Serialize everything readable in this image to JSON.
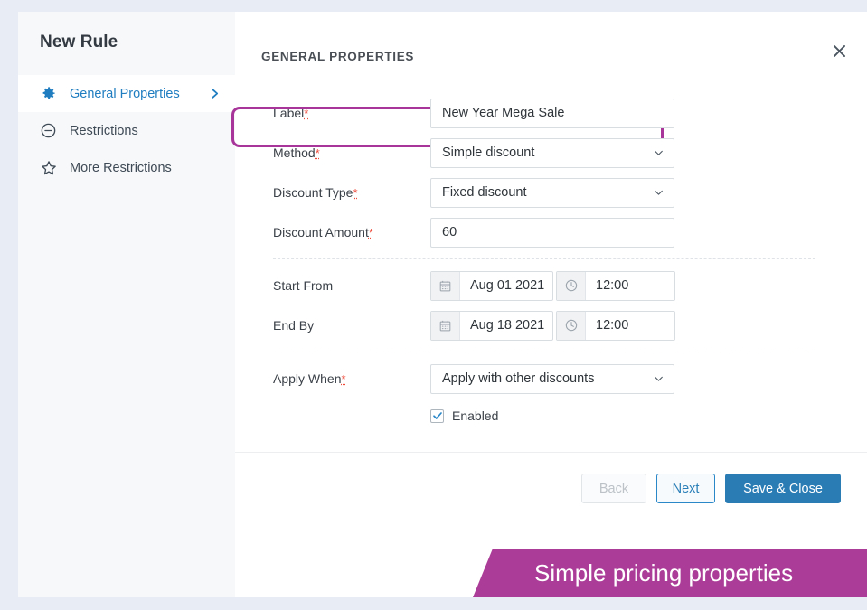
{
  "sidebar": {
    "title": "New Rule",
    "items": [
      {
        "label": "General Properties",
        "icon": "gear-icon",
        "active": true,
        "chevron": "chevron-right-icon"
      },
      {
        "label": "Restrictions",
        "icon": "circle-minus-icon",
        "active": false
      },
      {
        "label": "More Restrictions",
        "icon": "star-icon",
        "active": false
      }
    ]
  },
  "header": {
    "section_title": "GENERAL PROPERTIES",
    "close_icon": "close-icon"
  },
  "form": {
    "required_marker": "*",
    "fields": {
      "label": {
        "label": "Label",
        "value": "New Year Mega Sale",
        "required": true
      },
      "method": {
        "label": "Method",
        "value": "Simple discount",
        "required": true,
        "highlighted": true
      },
      "discount_type": {
        "label": "Discount Type",
        "value": "Fixed discount",
        "required": true
      },
      "discount_amount": {
        "label": "Discount Amount",
        "value": "60",
        "required": true
      },
      "start_from": {
        "label": "Start From",
        "date": "Aug 01 2021",
        "time": "12:00",
        "required": false
      },
      "end_by": {
        "label": "End By",
        "date": "Aug 18 2021",
        "time": "12:00",
        "required": false
      },
      "apply_when": {
        "label": "Apply When",
        "value": "Apply with other discounts",
        "required": true
      }
    },
    "enabled_checkbox": {
      "label": "Enabled",
      "checked": true
    }
  },
  "footer": {
    "back_label": "Back",
    "next_label": "Next",
    "save_label": "Save & Close"
  },
  "banner": {
    "text": "Simple pricing properties"
  },
  "colors": {
    "accent_blue": "#2a7cb5",
    "highlight_magenta": "#a8369a",
    "banner_magenta": "#ab3c97",
    "required_red": "#ee4b3a",
    "page_background": "#e8edf5"
  }
}
